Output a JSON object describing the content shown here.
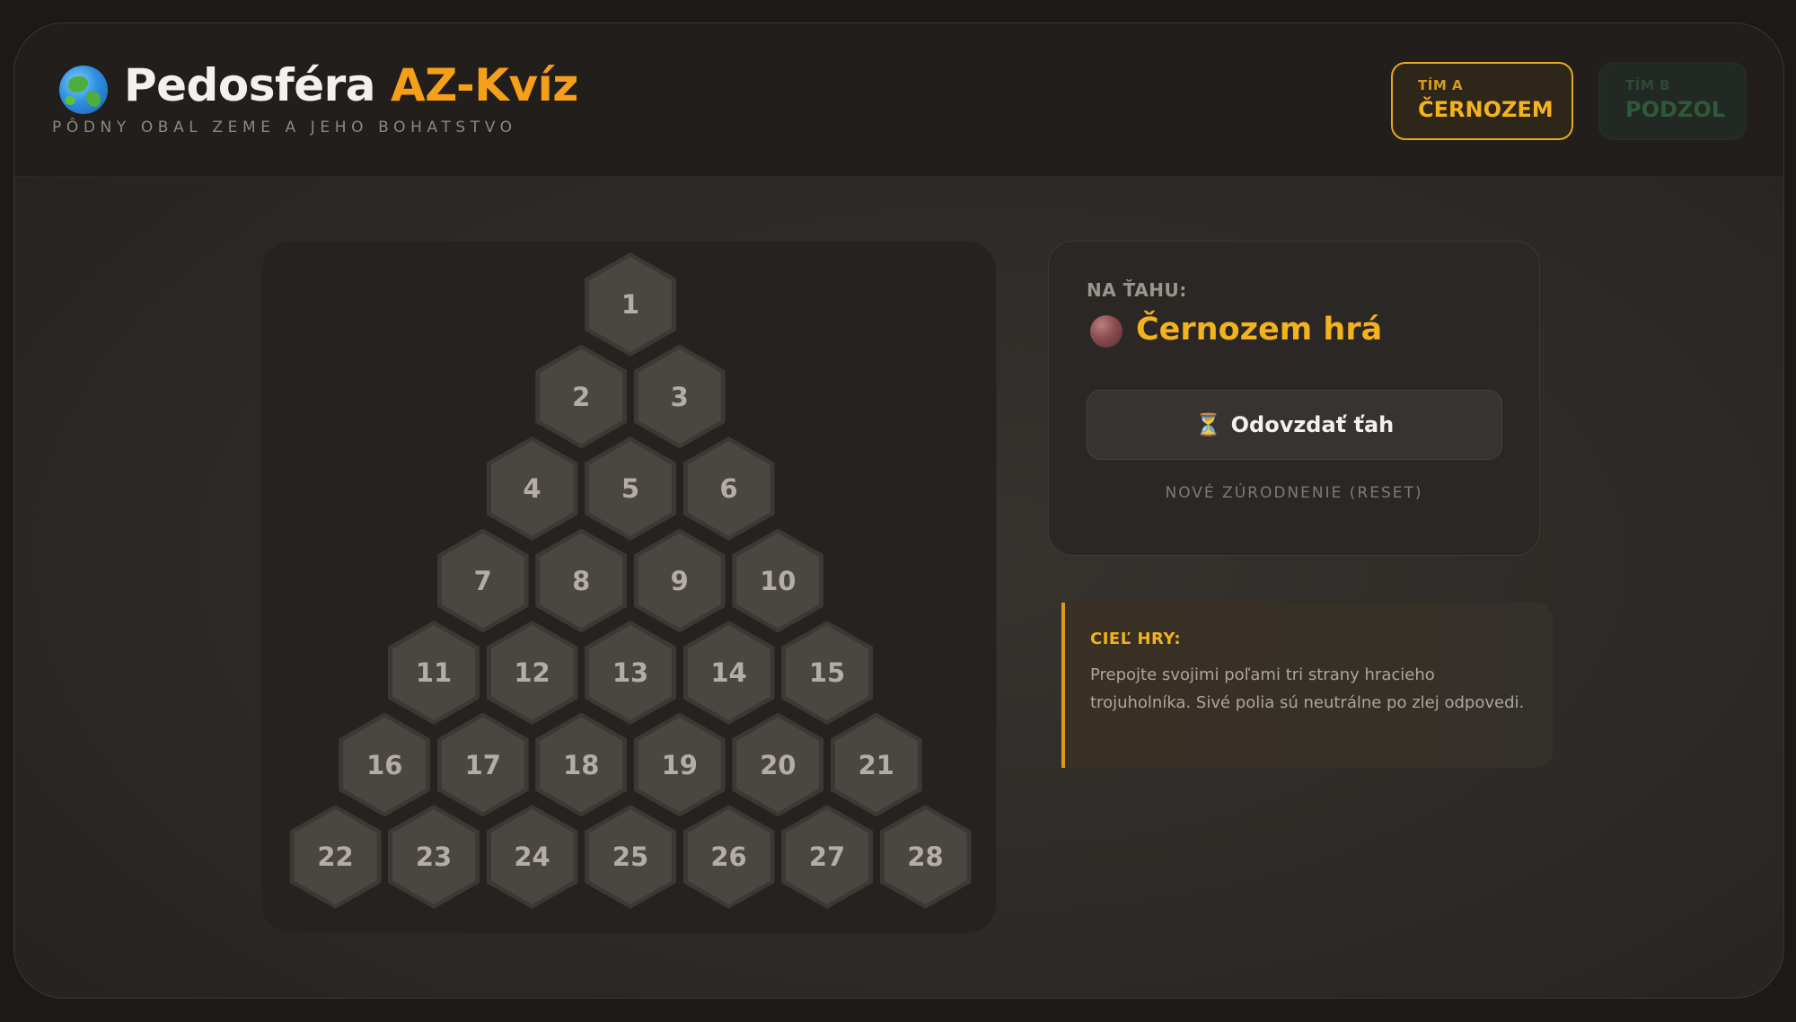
{
  "header": {
    "title_main": "Pedosféra",
    "title_accent": "AZ-Kvíz",
    "subtitle": "PÔDNY OBAL ZEME A JEHO BOHATSTVO",
    "logo_icon": "globe-icon"
  },
  "teams": [
    {
      "label": "TÍM A",
      "name": "ČERNOZEM",
      "active": true,
      "color": "#f4b21e"
    },
    {
      "label": "TÍM B",
      "name": "PODZOL",
      "active": false,
      "color": "#2e5a38"
    }
  ],
  "board": {
    "cells": [
      "1",
      "2",
      "3",
      "4",
      "5",
      "6",
      "7",
      "8",
      "9",
      "10",
      "11",
      "12",
      "13",
      "14",
      "15",
      "16",
      "17",
      "18",
      "19",
      "20",
      "21",
      "22",
      "23",
      "24",
      "25",
      "26",
      "27",
      "28"
    ]
  },
  "turn": {
    "label": "NA ŤAHU:",
    "player": "Černozem hrá",
    "player_color": "#8a4c50"
  },
  "actions": {
    "pass_icon": "hourglass-icon",
    "pass_label": "Odovzdať ťah",
    "reset_label": "NOVÉ ZÚRODNENIE (RESET)"
  },
  "goal": {
    "title": "CIEĽ HRY:",
    "text": "Prepojte svojimi poľami tri strany hracieho trojuholníka. Sivé polia sú neutrálne po zlej odpovedi."
  }
}
